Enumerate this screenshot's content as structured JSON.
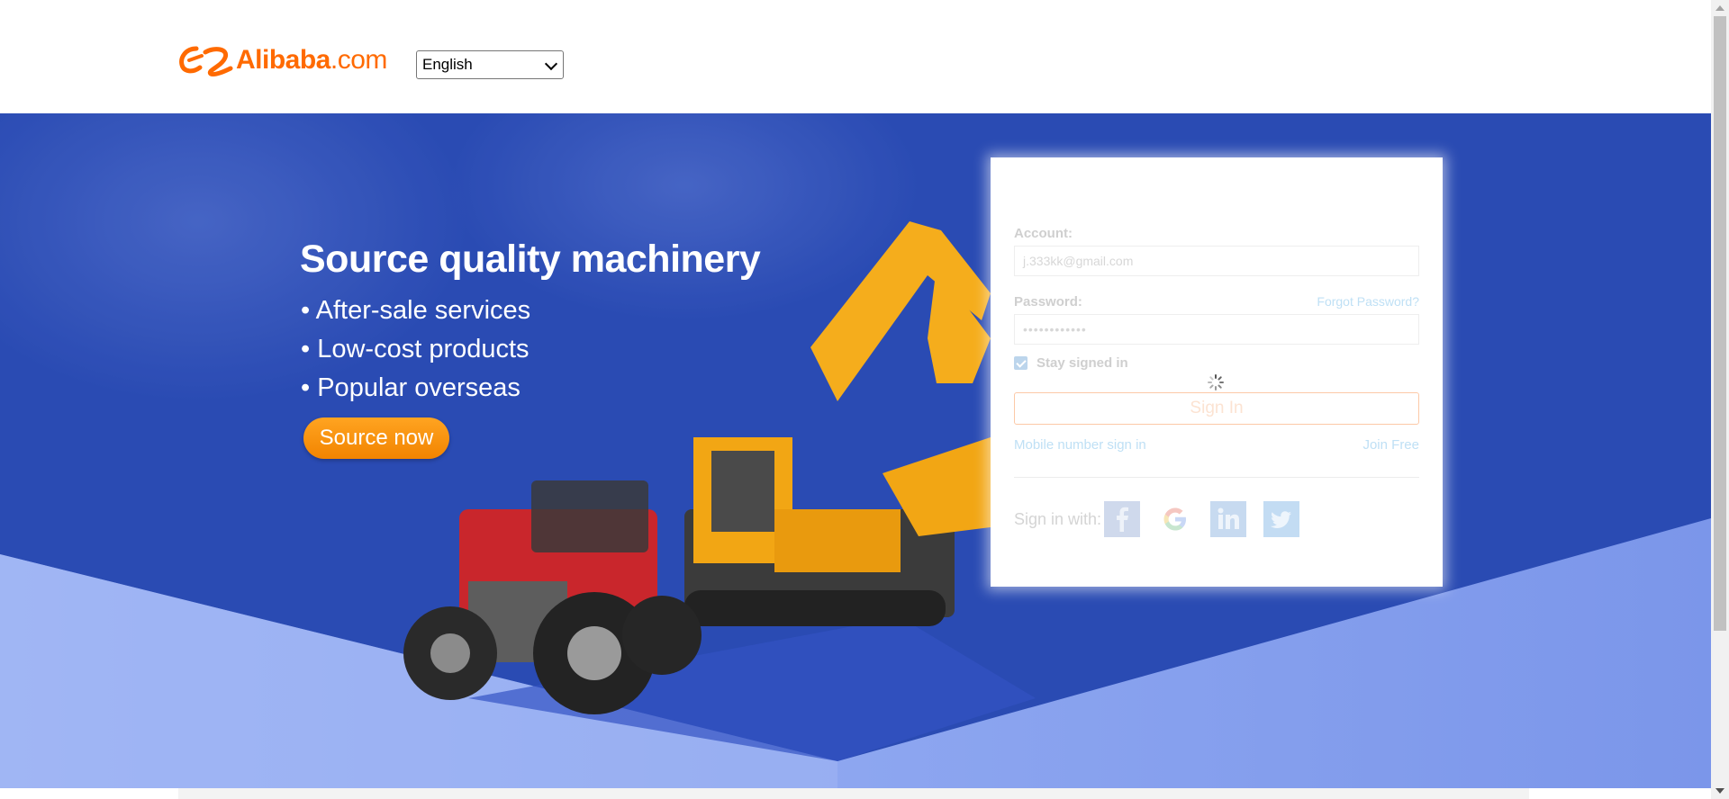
{
  "header": {
    "logo": {
      "brand": "Alibaba",
      "domain": ".com",
      "color": "#ff6a00"
    },
    "language_select": {
      "value": "English"
    }
  },
  "hero": {
    "title": "Source quality machinery",
    "bullets": [
      "After-sale services",
      "Low-cost products",
      "Popular overseas"
    ],
    "cta_label": "Source now",
    "colors": {
      "background": "#2f53b7",
      "cta": "#f7941d"
    }
  },
  "login": {
    "account_label": "Account:",
    "account_value": "j.333kk@gmail.com",
    "password_label": "Password:",
    "password_value": "••••••••••••",
    "forgot_password": "Forgot Password?",
    "stay_signed_in": "Stay signed in",
    "stay_signed_in_checked": true,
    "sign_in_label": "Sign In",
    "mobile_sign_in": "Mobile number sign in",
    "join_free": "Join Free",
    "sign_in_with": "Sign in with:",
    "social_icons": [
      "facebook-icon",
      "google-icon",
      "linkedin-icon",
      "twitter-icon"
    ]
  }
}
